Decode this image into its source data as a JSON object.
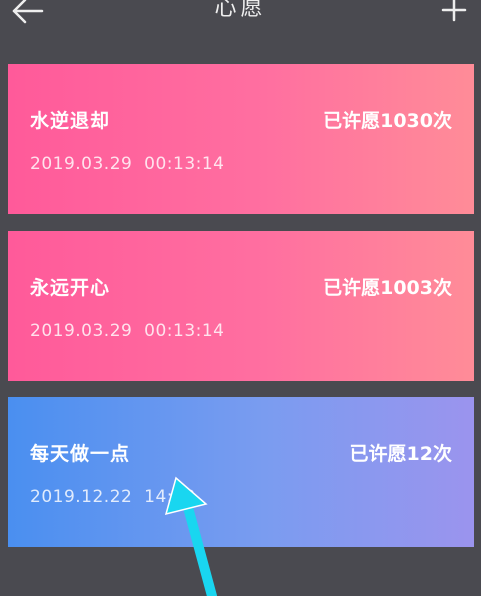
{
  "header": {
    "title": "心愿",
    "back_icon": "back-arrow-icon",
    "add_icon": "plus-icon"
  },
  "wishes": [
    {
      "name": "水逆退却",
      "count": "已许愿1030次",
      "date": "2019.03.29  00:13:14",
      "gradient": [
        "#ff5a9a",
        "#ff8c98"
      ]
    },
    {
      "name": "永远开心",
      "count": "已许愿1003次",
      "date": "2019.03.29  00:13:14",
      "gradient": [
        "#ff5a9a",
        "#ff8c98"
      ]
    },
    {
      "name": "每天做一点",
      "count": "已许愿12次",
      "date": "2019.12.22  14:33",
      "gradient": [
        "#4a8ff0",
        "#9b94ee"
      ]
    }
  ],
  "colors": {
    "background": "#4a4a50",
    "annotation_arrow": "#19d6f0"
  }
}
